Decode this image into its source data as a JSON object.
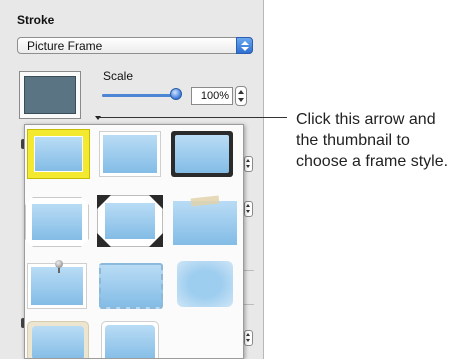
{
  "inspector": {
    "section_title": "Stroke",
    "stroke_popup": {
      "selected": "Picture Frame"
    },
    "scale": {
      "label": "Scale",
      "value": "100%",
      "slider_level_fraction": 0.95
    },
    "frame_swatch_color": "#5b7483"
  },
  "frame_styles_popover": {
    "styles": [
      "yellow-border-frame",
      "thin-white-frame",
      "dark-rounded-frame",
      "beveled-white-frame",
      "black-corner-frame",
      "taped-photo-frame",
      "pushpin-frame",
      "deckled-edge-frame",
      "soft-vignette-frame",
      "rounded-cream-frame",
      "rounded-white-frame"
    ],
    "selected_index": 0,
    "selected_highlight_color": "#f2e930"
  },
  "callout": {
    "text": "Click this arrow and\nthe thumbnail to\nchoose a frame style."
  }
}
